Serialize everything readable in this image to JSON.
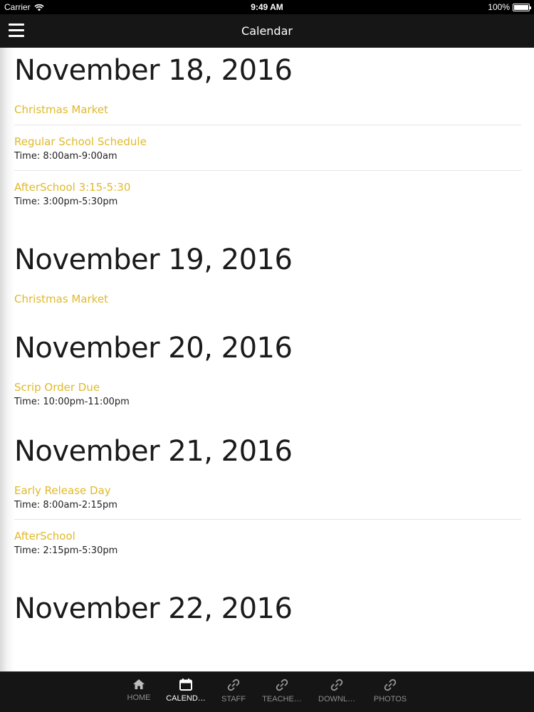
{
  "status": {
    "carrier": "Carrier",
    "time": "9:49 AM",
    "battery": "100%"
  },
  "nav": {
    "title": "Calendar"
  },
  "days": [
    {
      "date": "November 18, 2016",
      "events": [
        {
          "title": "Christmas Market"
        },
        {
          "title": "Regular School Schedule",
          "time_label": "Time:",
          "time": "8:00am-9:00am"
        },
        {
          "title": "AfterSchool 3:15-5:30",
          "time_label": "Time:",
          "time": "3:00pm-5:30pm"
        }
      ]
    },
    {
      "date": "November 19, 2016",
      "events": [
        {
          "title": "Christmas Market"
        }
      ]
    },
    {
      "date": "November 20, 2016",
      "events": [
        {
          "title": "Scrip Order Due",
          "time_label": "Time:",
          "time": "10:00pm-11:00pm"
        }
      ]
    },
    {
      "date": "November 21, 2016",
      "events": [
        {
          "title": "Early Release Day",
          "time_label": "Time:",
          "time": "8:00am-2:15pm"
        },
        {
          "title": "AfterSchool",
          "time_label": "Time:",
          "time": "2:15pm-5:30pm"
        }
      ]
    },
    {
      "date": "November 22, 2016",
      "events": []
    }
  ],
  "tabs": [
    {
      "label": "HOME",
      "icon": "home-icon",
      "active": false
    },
    {
      "label": "CALEND…",
      "icon": "calendar-icon",
      "active": true
    },
    {
      "label": "STAFF",
      "icon": "link-icon",
      "active": false
    },
    {
      "label": "TEACHE…",
      "icon": "link-icon",
      "active": false
    },
    {
      "label": "DOWNL…",
      "icon": "link-icon",
      "active": false
    },
    {
      "label": "PHOTOS",
      "icon": "link-icon",
      "active": false
    }
  ],
  "colors": {
    "accent": "#e0b92a",
    "nav_bg": "#161616",
    "tab_bg": "#151515"
  }
}
